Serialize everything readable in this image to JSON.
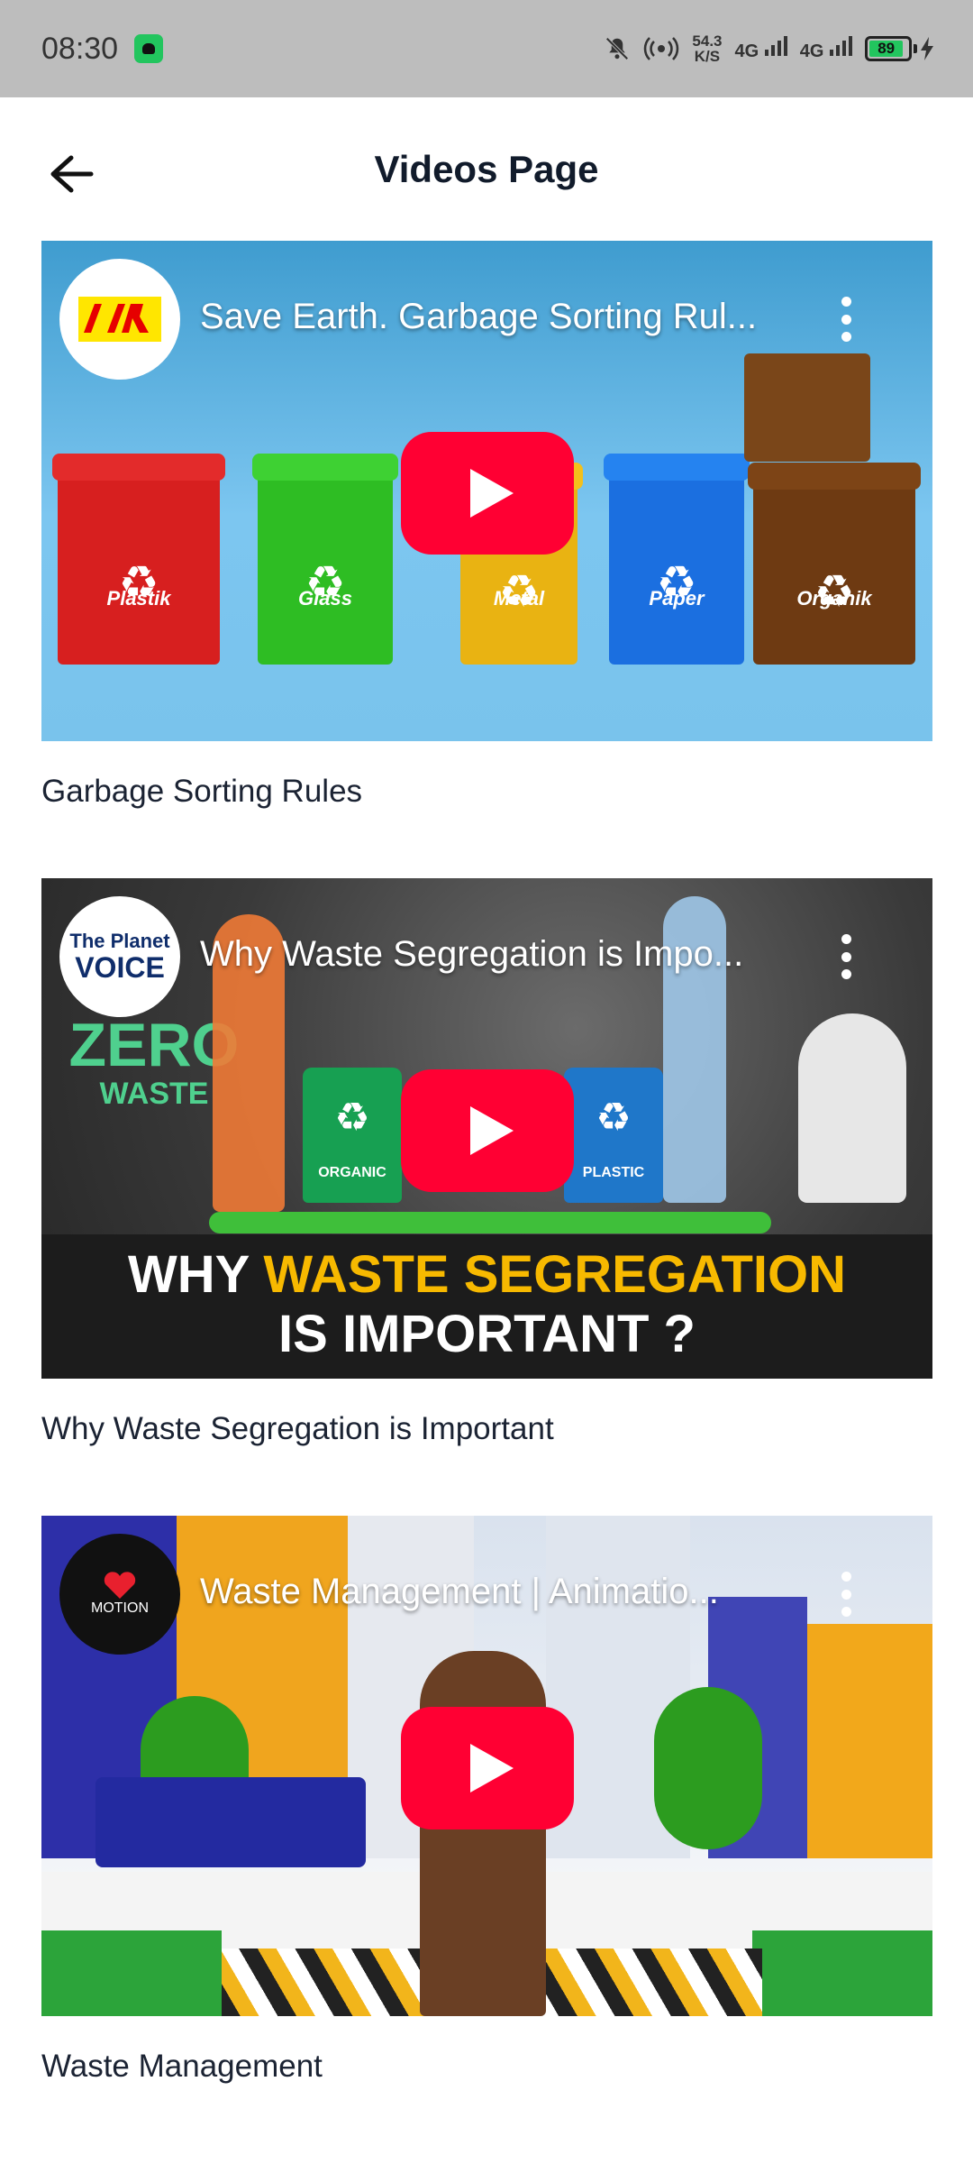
{
  "status_bar": {
    "time": "08:30",
    "speed_value": "54.3",
    "speed_unit": "K/S",
    "network_1": "4G",
    "network_2": "4G",
    "battery": "89"
  },
  "header": {
    "title": "Videos Page"
  },
  "videos": [
    {
      "title": "Save Earth. Garbage Sorting Rul...",
      "caption": "Garbage Sorting Rules",
      "bins": [
        "Plastik",
        "Glass",
        "Metal",
        "Paper",
        "Organik"
      ]
    },
    {
      "title": "Why Waste Segregation is Impo...",
      "caption": "Why Waste Segregation is Important",
      "channel_line1": "The Planet",
      "channel_line2": "VOICE",
      "art_zero": "ZERO",
      "art_waste": "WASTE",
      "bin_organic": "ORGANIC",
      "bin_plastic": "PLASTIC",
      "banner_why": "WHY",
      "banner_highlight": "WASTE SEGREGATION",
      "banner_line2": "IS IMPORTANT ?"
    },
    {
      "title": "Waste Management | Animatio...",
      "caption": "Waste Management",
      "channel_name": "MOTION"
    }
  ],
  "colors": {
    "youtube_red": "#ff0033",
    "status_bar_bg": "#bdbdbd",
    "banner_yellow": "#f7b900"
  }
}
